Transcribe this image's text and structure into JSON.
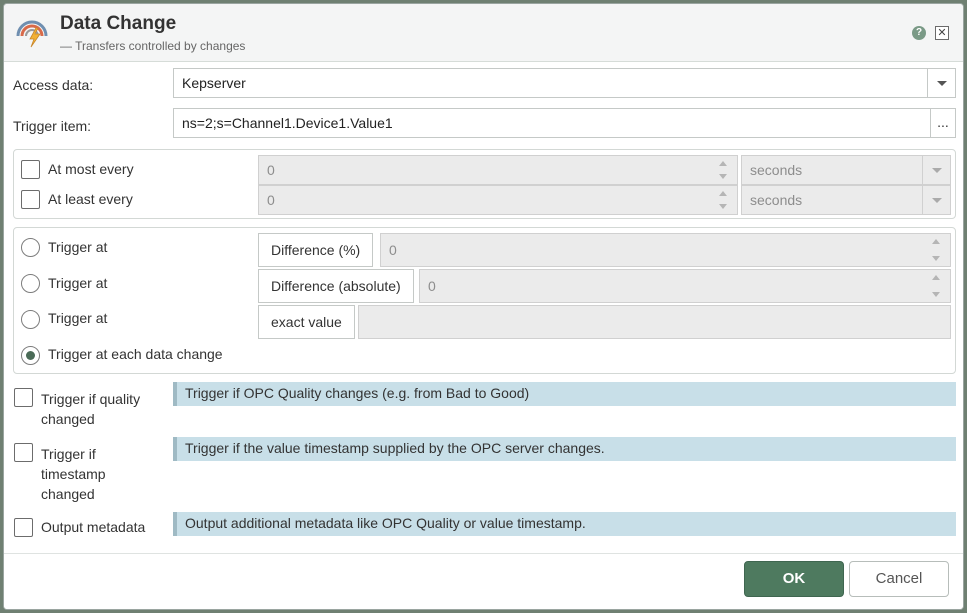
{
  "dialog": {
    "title": "Data Change",
    "subtitle": "— Transfers controlled by changes",
    "help_glyph": "?",
    "close_glyph": "✕",
    "icons": {
      "app": "gauge-lightning-icon",
      "help": "help-icon",
      "close": "close-icon"
    }
  },
  "access_data": {
    "label": "Access data:",
    "value": "Kepserver"
  },
  "trigger_item": {
    "label": "Trigger item:",
    "value": "ns=2;s=Channel1.Device1.Value1",
    "browse_label": "..."
  },
  "limits": [
    {
      "label": "At most every",
      "checked": false,
      "value": "0",
      "unit": "seconds"
    },
    {
      "label": "At least every",
      "checked": false,
      "value": "0",
      "unit": "seconds"
    }
  ],
  "trigger_modes": [
    {
      "label": "Trigger at",
      "mode": "Difference (%)",
      "value": "0",
      "selected": false
    },
    {
      "label": "Trigger at",
      "mode": "Difference (absolute)",
      "value": "0",
      "selected": false
    },
    {
      "label": "Trigger at",
      "mode": "exact value",
      "value": "",
      "selected": false
    },
    {
      "label": "Trigger at each data change",
      "selected": true
    }
  ],
  "options": [
    {
      "label": "Trigger if quality changed",
      "label_lines": [
        "Trigger if quality",
        "changed"
      ],
      "checked": false,
      "info": "Trigger if OPC Quality changes (e.g. from Bad to Good)"
    },
    {
      "label": "Trigger if timestamp changed",
      "label_lines": [
        "Trigger if",
        "timestamp",
        "changed"
      ],
      "checked": false,
      "info": "Trigger if the value timestamp supplied by the OPC server changes."
    },
    {
      "label": "Output metadata",
      "label_lines": [
        "Output metadata"
      ],
      "checked": false,
      "info": "Output additional metadata like OPC Quality or value timestamp."
    }
  ],
  "footer": {
    "ok_label": "OK",
    "cancel_label": "Cancel"
  },
  "colors": {
    "primary": "#4e7a5f",
    "info_bg": "#c8dfe8",
    "titlebar_bg": "#f4f5f5"
  }
}
